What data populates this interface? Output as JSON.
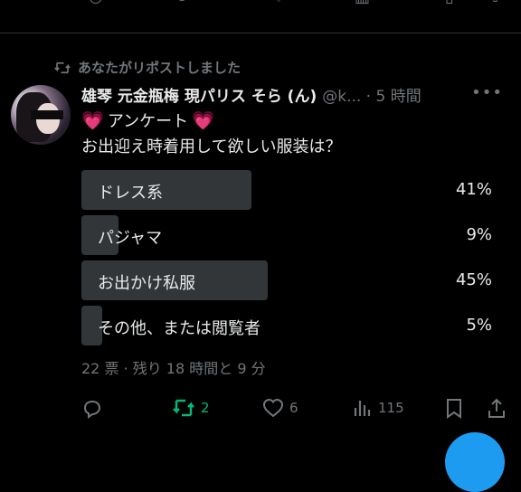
{
  "repost_text": "あなたがリポストしました",
  "author": {
    "name": "雄琴 元金瓶梅 現パリス そら (ん)",
    "handle_time": "@k... · 5 時間"
  },
  "tweet": {
    "line1": "アンケート",
    "line2": "お出迎え時着用して欲しい服装は？"
  },
  "poll": {
    "options": [
      {
        "label": "ドレス系",
        "percent_text": "41%",
        "percent": 41
      },
      {
        "label": "パジャマ",
        "percent_text": "9%",
        "percent": 9
      },
      {
        "label": "お出かけ私服",
        "percent_text": "45%",
        "percent": 45
      },
      {
        "label": "その他、または閲覧者",
        "percent_text": "5%",
        "percent": 5
      }
    ],
    "meta": "22 票 · 残り 18 時間と 9 分"
  },
  "actions": {
    "reposts": "2",
    "likes": "6",
    "views": "115"
  },
  "colors": {
    "background": "#000000",
    "text": "#e7e9ea",
    "muted": "#71767b",
    "bar": "#333639",
    "repost_green": "#00ba7c",
    "heart_pink": "#ff4fa3",
    "accent_blue": "#1d9bf0"
  }
}
